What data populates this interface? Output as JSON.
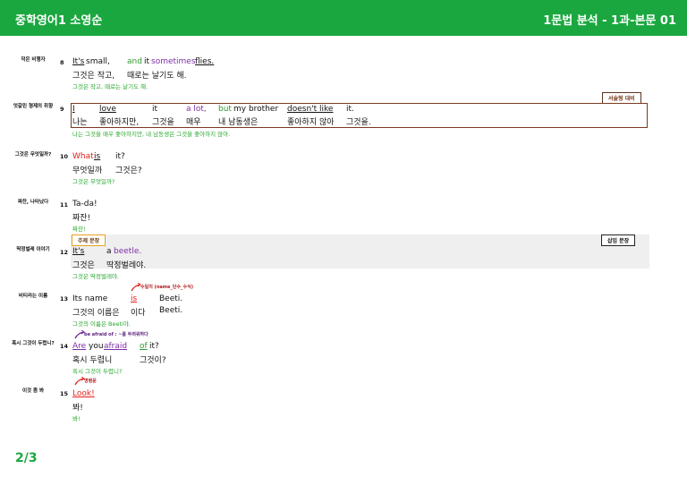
{
  "header": {
    "left": "중학영어1 소영순",
    "right": "1문법 분석 - 1과-본문 01"
  },
  "page": "2/3",
  "tags": {
    "contrast": "서술형 대비",
    "topic_sentence": "주제 문장",
    "inserted": "삽입 문장"
  },
  "notes": {
    "n13": "수일치 (name_단수_수식)",
    "n14": "be afraid of : ~를 두려워하다",
    "n15": "명령문"
  },
  "rows": [
    {
      "topic": "작은 비행자",
      "num": "8",
      "en": [
        "It's",
        "small,",
        "and",
        "it",
        "sometimes",
        "flies."
      ],
      "ko": [
        "그것은 작고,",
        "때로는 날기도 해."
      ],
      "tr": "그것은 작고, 때로는 날기도 해."
    },
    {
      "topic": "엇갈린 형제의 취향",
      "num": "9",
      "en": [
        "I",
        "love",
        "it",
        "a lot,",
        "but",
        "my brother",
        "doesn't like",
        "it."
      ],
      "ko": [
        "나는",
        "좋아하지만,",
        "그것을",
        "매우",
        "내 남동생은",
        "좋아하지 않아",
        "그것을."
      ],
      "tr": "나는 그것을 매우 좋아하지만, 내 남동생은 그것을 좋아하지 않아."
    },
    {
      "topic": "그것은 무엇일까?",
      "num": "10",
      "en": [
        "What",
        "is",
        "it?"
      ],
      "ko": [
        "무엇일까",
        "그것은?"
      ],
      "tr": "그것은 무엇일까?"
    },
    {
      "topic": "짜잔, 나타났다",
      "num": "11",
      "en": [
        "Ta-da!"
      ],
      "ko": [
        "짜잔!"
      ],
      "tr": "짜잔!"
    },
    {
      "topic": "딱정벌레 이야기",
      "num": "12",
      "en": [
        "It's",
        "a",
        "beetle."
      ],
      "ko": [
        "그것은",
        "딱정벌레야."
      ],
      "tr": "그것은 딱정벌레야."
    },
    {
      "topic": "비티라는 이름",
      "num": "13",
      "en": [
        "Its name",
        "is",
        "Beeti."
      ],
      "ko": [
        "그것의 이름은",
        "이다",
        "Beeti."
      ],
      "tr": "그것의 이름은 Beeti야."
    },
    {
      "topic": "혹시 그것이 두렵니?",
      "num": "14",
      "en": [
        "Are",
        "you",
        "afraid",
        "of",
        "it?"
      ],
      "ko": [
        "혹시 두렵니",
        "그것이?"
      ],
      "tr": "혹시 그것이 두렵니?"
    },
    {
      "topic": "이것 좀 봐",
      "num": "15",
      "en": [
        "Look!"
      ],
      "ko": [
        "봐!"
      ],
      "tr": "봐!"
    }
  ]
}
